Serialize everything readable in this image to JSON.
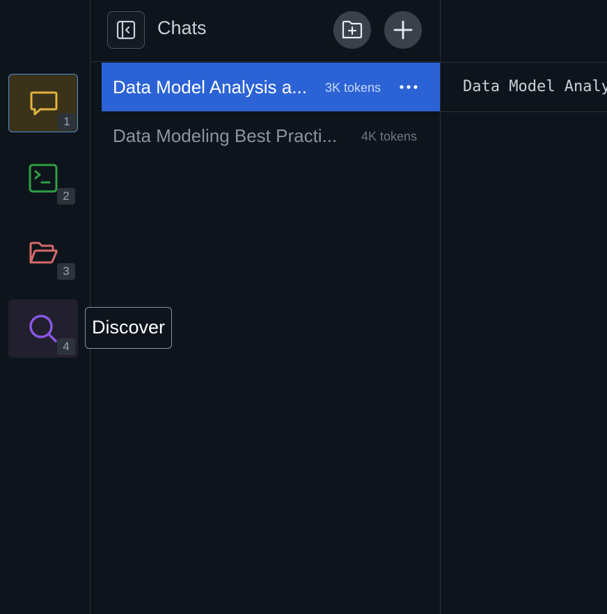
{
  "rail": {
    "items": [
      {
        "name": "chats",
        "icon": "chat-bubble-icon",
        "badge": "1",
        "color": "#e3b341",
        "state": "active"
      },
      {
        "name": "terminal",
        "icon": "terminal-icon",
        "badge": "2",
        "color": "#2ea043",
        "state": "normal"
      },
      {
        "name": "files",
        "icon": "folder-open-icon",
        "badge": "3",
        "color": "#d46a6a",
        "state": "normal"
      },
      {
        "name": "discover",
        "icon": "search-icon",
        "badge": "4",
        "color": "#8957e5",
        "state": "hover"
      }
    ],
    "tooltip": "Discover"
  },
  "panel": {
    "title": "Chats",
    "chats": [
      {
        "title": "Data Model Analysis a...",
        "tokens": "3K tokens",
        "selected": true
      },
      {
        "title": "Data Modeling Best Practi...",
        "tokens": "4K tokens",
        "selected": false
      }
    ]
  },
  "main": {
    "tab_title": "Data Model Analy"
  },
  "colors": {
    "background": "#0e141b",
    "selection": "#2b63d6",
    "border": "#2b323b"
  }
}
